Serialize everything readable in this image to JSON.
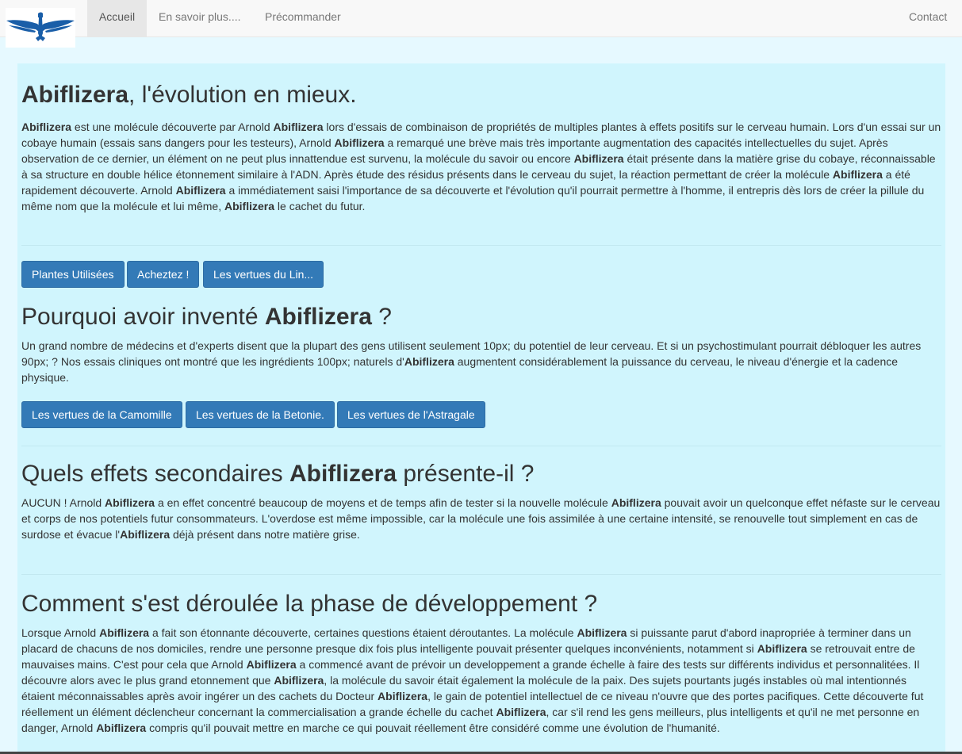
{
  "nav": {
    "logo_alt": "eagle logo",
    "links": [
      "Accueil",
      "En savoir plus....",
      "Précommander"
    ],
    "contact": "Contact"
  },
  "brand": "Abiflizera",
  "hero": {
    "title_suffix": ", l'évolution en mieux.",
    "p": [
      "",
      " est une molécule découverte par Arnold ",
      "",
      " lors d'essais de combinaison de propriétés de multiples plantes à effets positifs sur le cerveau humain. Lors d'un essai sur un cobaye humain (essais sans dangers pour les testeurs), Arnold ",
      "",
      " a remarqué une brève mais très importante augmentation des capacités intellectuelles du sujet. Après observation de ce dernier, un élément on ne peut plus innattendue est survenu, la molécule du savoir ou encore ",
      "",
      " était présente dans la matière grise du cobaye, réconnaissable à sa structure en double hélice étonnement similaire à l'ADN. Après étude des résidus présents dans le cerveau du sujet, la réaction permettant de créer la molécule ",
      "",
      " a été rapidement découverte. Arnold ",
      "",
      " a immédiatement saisi l'importance de sa découverte et l'évolution qu'il pourrait permettre à l'homme, il entrepris dès lors de créer la pillule du même nom que la molécule et lui même, ",
      "",
      " le cachet du futur."
    ]
  },
  "buttons1": [
    "Plantes Utilisées",
    "Acheztez !",
    "Les vertues du Lin..."
  ],
  "section2": {
    "title_prefix": "Pourquoi avoir inventé ",
    "title_suffix": " ?",
    "p": [
      "Un grand nombre de médecins et d'experts disent que la plupart des gens utilisent seulement 10px; du potentiel de leur cerveau. Et si un psychostimulant pourrait débloquer les autres 90px; ? Nos essais cliniques ont montré que les ingrédients 100px; naturels d'",
      "",
      " augmentent considérablement la puissance du cerveau, le niveau d'énergie et la cadence physique."
    ]
  },
  "buttons2": [
    "Les vertues de la Camomille",
    "Les vertues de la Betonie.",
    "Les vertues de l'Astragale"
  ],
  "section3": {
    "title_prefix": "Quels effets secondaires ",
    "title_suffix": " présente-il ?",
    "p": [
      "AUCUN ! Arnold ",
      "",
      " a en effet concentré beaucoup de moyens et de temps afin de tester si la nouvelle molécule ",
      "",
      " pouvait avoir un quelconque effet néfaste sur le cerveau et corps de nos potentiels futur consommateurs. L'overdose est même impossible, car la molécule une fois assimilée à une certaine intensité, se renouvelle tout simplement en cas de surdose et évacue l'",
      "",
      " déjà présent dans notre matière grise."
    ]
  },
  "section4": {
    "title": "Comment s'est déroulée la phase de développement ?",
    "p": [
      "Lorsque Arnold ",
      "",
      " a fait son étonnante découverte, certaines questions étaient déroutantes. La molécule ",
      "",
      " si puissante parut d'abord inapropriée à terminer dans un placard de chacuns de nos domiciles, rendre une personne presque dix fois plus intelligente pouvait présenter quelques inconvénients, notamment si ",
      "",
      " se retrouvait entre de mauvaises mains. C'est pour cela que Arnold ",
      "",
      " a commencé avant de prévoir un developpement a grande échelle à faire des tests sur différents individus et personnalitées. Il découvre alors avec le plus grand etonnement que ",
      "",
      ", la molécule du savoir était également la molécule de la paix. Des sujets pourtants jugés instables où mal intentionnés étaient méconnaissables après avoir ingérer un des cachets du Docteur ",
      "",
      ", le gain de potentiel intellectuel de ce niveau n'ouvre que des portes pacifiques. Cette découverte fut réellement un élément déclencheur concernant la commercialisation a grande échelle du cachet ",
      "",
      ", car s'il rend les gens meilleurs, plus intelligents et qu'il ne met personne en danger, Arnold ",
      "",
      " compris qu'il pouvait mettre en marche ce qui pouvait réellement être considéré comme une évolution de l'humanité."
    ]
  },
  "colors": {
    "accent": "#337ab7",
    "panel": "#d0f5fd",
    "page": "#e6f9ff",
    "logo": "#1a5ea8"
  }
}
